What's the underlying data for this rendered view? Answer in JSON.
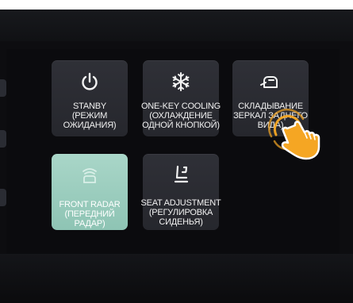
{
  "tiles": [
    {
      "id": "standby",
      "icon": "power-icon",
      "lines": [
        "STANBY",
        "(РЕЖИМ",
        "ОЖИДАНИЯ)"
      ],
      "active": false
    },
    {
      "id": "one-key-cooling",
      "icon": "snowflake-icon",
      "lines": [
        "ONE-KEY COOLING",
        "(ОХЛАЖДЕНИЕ",
        "ОДНОЙ КНОПКОЙ)"
      ],
      "active": false
    },
    {
      "id": "mirror-folding",
      "icon": "mirror-fold-icon",
      "lines": [
        "СКЛАДЫВАНИЕ",
        "ЗЕРКАЛ ЗАДНЕГО",
        "ВИДА)"
      ],
      "active": false
    },
    {
      "id": "front-radar",
      "icon": "radar-icon",
      "lines": [
        "FRONT RADAR",
        "(ПЕРЕДНИЙ",
        "РАДАР)"
      ],
      "active": true
    },
    {
      "id": "seat-adjustment",
      "icon": "seat-icon",
      "lines": [
        "SEAT ADJUSTMENT",
        "(РЕГУЛИРОВКА",
        "СИДЕНЬЯ)"
      ],
      "active": false
    }
  ],
  "colors": {
    "tile": "#2b2c32",
    "tile_active": "#9fd0c1",
    "text": "#f2f2f2",
    "hand": "#f5a623"
  },
  "pointer": {
    "icon": "tap-hand-icon"
  }
}
